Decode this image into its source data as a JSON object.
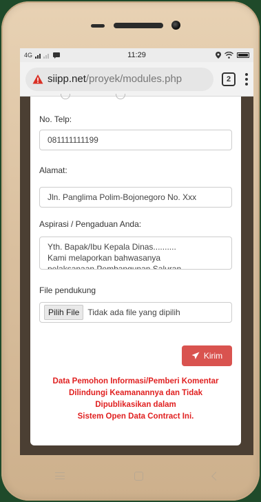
{
  "status_bar": {
    "network": "4G",
    "time": "11:29"
  },
  "browser": {
    "url_host": "siipp.net",
    "url_path": "/proyek/modules.php",
    "tab_count": "2"
  },
  "form": {
    "phone": {
      "label": "No. Telp:",
      "value": "081111111199"
    },
    "address": {
      "label": "Alamat:",
      "value": "Jln. Panglima Polim-Bojonegoro No. Xxx"
    },
    "aspiration": {
      "label": "Aspirasi / Pengaduan Anda:",
      "line1": "Yth. Bapak/Ibu Kepala Dinas..........",
      "line2": "Kami melaporkan bahwasanya",
      "line3": "pelaksanaan Pembangunan Saluran"
    },
    "file": {
      "label": "File pendukung",
      "button": "Pilih File",
      "status": "Tidak ada file yang dipilih"
    },
    "submit_label": "Kirim"
  },
  "notice": {
    "line1": "Data Pemohon Informasi/Pemberi Komentar",
    "line2": "Dilindungi Keamanannya dan Tidak",
    "line3": "Dipublikasikan dalam",
    "line4": "Sistem Open Data Contract Ini."
  },
  "colors": {
    "submit": "#d9534f",
    "notice": "#e02020",
    "warning": "#d93025"
  }
}
